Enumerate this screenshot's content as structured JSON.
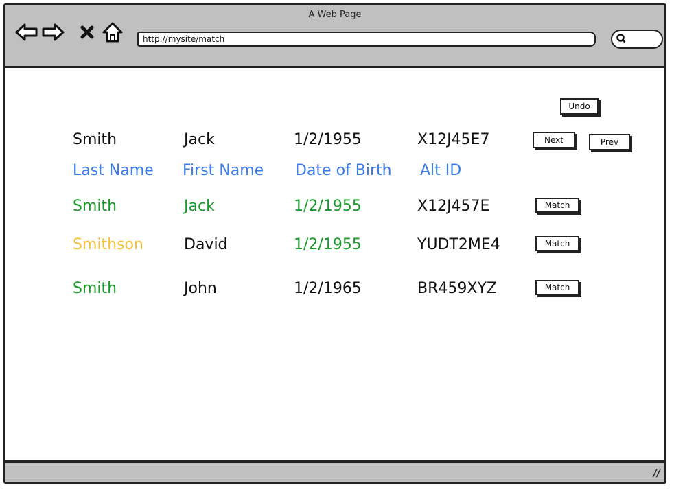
{
  "browser": {
    "title": "A Web Page",
    "url": "http://mysite/match",
    "icons": [
      "back-arrow-icon",
      "forward-arrow-icon",
      "stop-icon",
      "home-icon",
      "search-icon",
      "resize-grip-icon"
    ]
  },
  "toolbar": {
    "undo_label": "Undo",
    "next_label": "Next",
    "prev_label": "Prev"
  },
  "record": {
    "last_name": "Smith",
    "first_name": "Jack",
    "dob": "1/2/1955",
    "alt_id": "X12J45E7"
  },
  "columns": [
    "Last Name",
    "First Name",
    "Date of Birth",
    "Alt ID"
  ],
  "colors": {
    "header": "#3b7be8",
    "match": "#1a9a2a",
    "partial": "#f3c13a",
    "none": "#111111"
  },
  "candidates": [
    {
      "last_name": "Smith",
      "last_name_status": "match",
      "first_name": "Jack",
      "first_name_status": "match",
      "dob": "1/2/1955",
      "dob_status": "match",
      "alt_id": "X12J457E",
      "alt_id_status": "none",
      "action_label": "Match"
    },
    {
      "last_name": "Smithson",
      "last_name_status": "partial",
      "first_name": "David",
      "first_name_status": "none",
      "dob": "1/2/1955",
      "dob_status": "match",
      "alt_id": "YUDT2ME4",
      "alt_id_status": "none",
      "action_label": "Match"
    },
    {
      "last_name": "Smith",
      "last_name_status": "match",
      "first_name": "John",
      "first_name_status": "none",
      "dob": "1/2/1965",
      "dob_status": "none",
      "alt_id": "BR459XYZ",
      "alt_id_status": "none",
      "action_label": "Match"
    }
  ]
}
